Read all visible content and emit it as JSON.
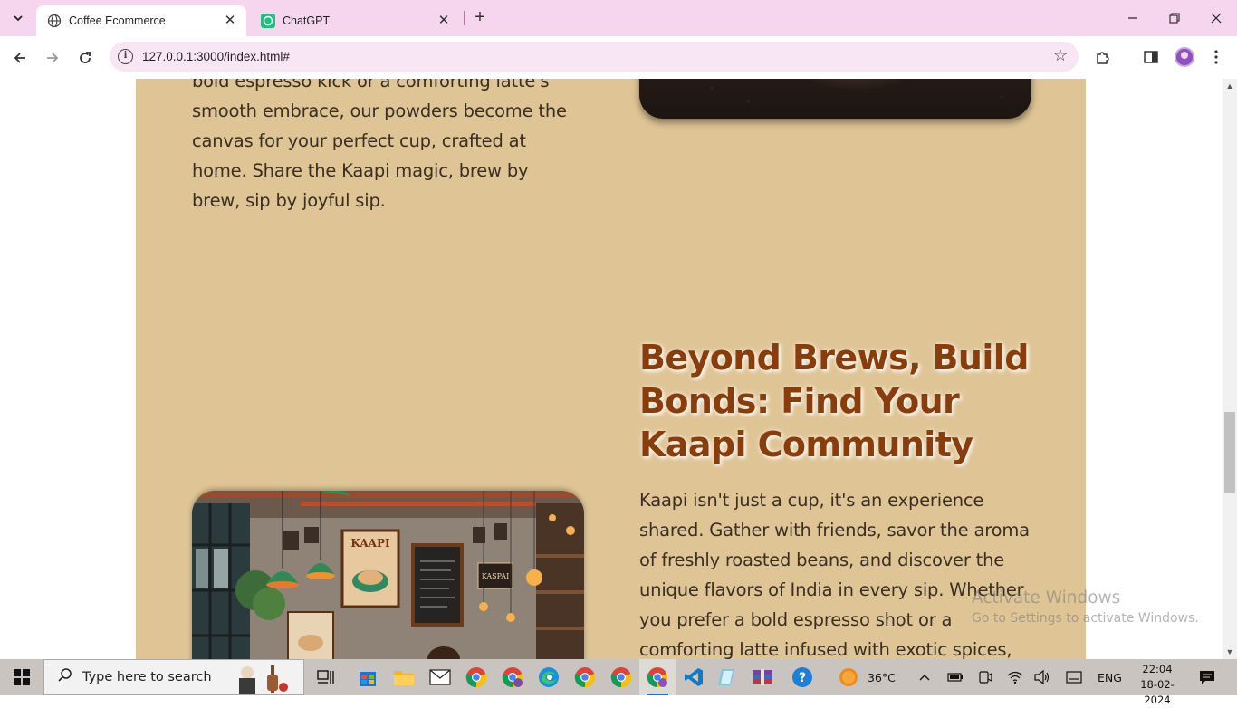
{
  "browser": {
    "tabs": [
      {
        "title": "Coffee Ecommerce",
        "active": true
      },
      {
        "title": "ChatGPT",
        "active": false
      }
    ],
    "url": "127.0.0.1:3000/index.html#"
  },
  "page": {
    "intro_paragraph": "bold espresso kick or a comforting latte's smooth embrace, our powders become the canvas for your perfect cup, crafted at home. Share the Kaapi magic, brew by brew, sip by joyful sip.",
    "section_heading": "Beyond Brews, Build Bonds: Find Your Kaapi Community",
    "section_paragraph": "Kaapi isn't just a cup, it's an experience shared. Gather with friends, savor the aroma of freshly roasted beans, and discover the unique flavors of India in every sip. Whether you prefer a bold espresso shot or a comforting latte infused with exotic spices, our baristas craft your perfect",
    "cafe_image": {
      "poster_text": "KAAPI",
      "sign_text": "KASPAI"
    }
  },
  "watermark": {
    "line1": "Activate Windows",
    "line2": "Go to Settings to activate Windows."
  },
  "taskbar": {
    "search_placeholder": "Type here to search",
    "weather": "36°C",
    "language": "ENG",
    "time": "22:04",
    "date": "18-02-2024"
  },
  "colors": {
    "accent": "#8a3d0c",
    "content_bg": "#dfc596",
    "tab_strip": "#f6d5ef"
  }
}
